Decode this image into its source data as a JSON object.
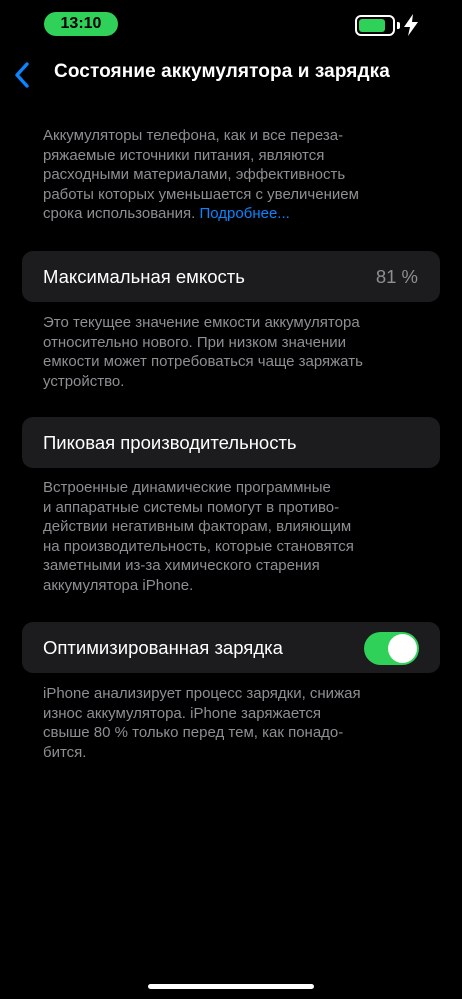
{
  "status_bar": {
    "time": "13:10",
    "battery_level": 0.82,
    "battery_color": "#30d158",
    "charging_icon": "bolt-icon"
  },
  "nav": {
    "title": "Состояние аккумулятора и зарядка",
    "back_icon": "chevron-left-icon"
  },
  "intro": {
    "lines": [
      "Аккумуляторы телефона, как и все переза-",
      "ряжаемые источники питания, являются",
      "расходными материалами, эффективность",
      "работы которых уменьшается с увеличением",
      "срока использования."
    ],
    "link": "Подробнее..."
  },
  "capacity": {
    "label": "Максимальная емкость",
    "value": "81 %",
    "lines": [
      "Это текущее значение емкости аккумулятора",
      "относительно нового. При низком значении",
      "емкости может потребоваться чаще заряжать",
      "устройство."
    ]
  },
  "performance": {
    "label": "Пиковая производительность",
    "lines": [
      "Встроенные динамические программные",
      "и аппаратные системы помогут в противо-",
      "действии негативным факторам, влияющим",
      "на производительность, которые становятся",
      "заметными из-за химического старения",
      "аккумулятора iPhone."
    ]
  },
  "optimized": {
    "label": "Оптимизированная зарядка",
    "enabled": true,
    "lines": [
      "iPhone анализирует процесс зарядки, снижая",
      "износ аккумулятора. iPhone заряжается",
      "свыше 80 % только перед тем, как понадо-",
      "бится."
    ]
  },
  "colors": {
    "accent": "#0a84ff",
    "toggle_on": "#30d158",
    "cell_bg": "#1c1c1e",
    "secondary_text": "#8e8e93"
  }
}
